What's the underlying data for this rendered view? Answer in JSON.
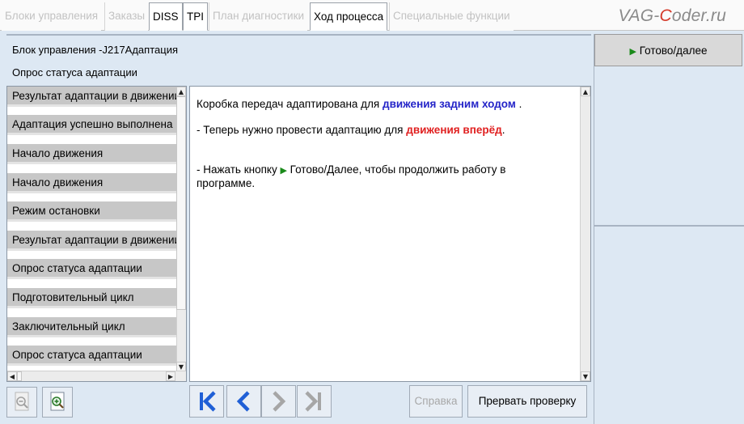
{
  "tabs": [
    {
      "label": "Блоки управления",
      "active": false
    },
    {
      "label": "Заказы",
      "active": false
    },
    {
      "label": "DISS",
      "active": true
    },
    {
      "label": "TPI",
      "active": true
    },
    {
      "label": "План диагностики",
      "active": false
    },
    {
      "label": "Ход процесса",
      "active": true
    },
    {
      "label": "Специальные функции",
      "active": false
    }
  ],
  "logo": {
    "part1": "VAG-",
    "part2": "C",
    "part3": "oder.ru"
  },
  "header": {
    "line1": "Блок управления -J217Адаптация",
    "line2": "Опрос статуса адаптации"
  },
  "steps": [
    "Результат адаптации в движении",
    "Адаптация успешно выполнена",
    "Начало движения",
    "Начало движения",
    "Режим остановки",
    "Результат адаптации в движении",
    "Опрос статуса адаптации",
    "Подготовительный цикл",
    "Заключительный цикл",
    "Опрос статуса адаптации"
  ],
  "message": {
    "p1_before": "Коробка передач адаптирована для ",
    "p1_bold": "движения задним ходом",
    "p1_after": " .",
    "p2_before": "- Теперь нужно провести адаптацию для ",
    "p2_bold": "движения вперёд",
    "p2_after": ".",
    "p3_before": "- Нажать кнопку ",
    "p3_after": " Готово/Далее, чтобы продолжить работу в",
    "p3_line2": "программе."
  },
  "buttons": {
    "help": "Справка",
    "abort": "Прервать проверку",
    "done": "Готово/далее"
  },
  "icons": {
    "zoom_out": "zoom-out-icon",
    "zoom_in": "zoom-in-icon",
    "first": "skip-first-icon",
    "prev": "chevron-left-icon",
    "next": "chevron-right-icon",
    "last": "skip-last-icon",
    "play": "play-triangle-icon"
  },
  "colors": {
    "highlight_blue": "#2424c8",
    "highlight_red": "#e02020",
    "nav_blue": "#1f5fd6",
    "play_green": "#1a8a1a"
  }
}
